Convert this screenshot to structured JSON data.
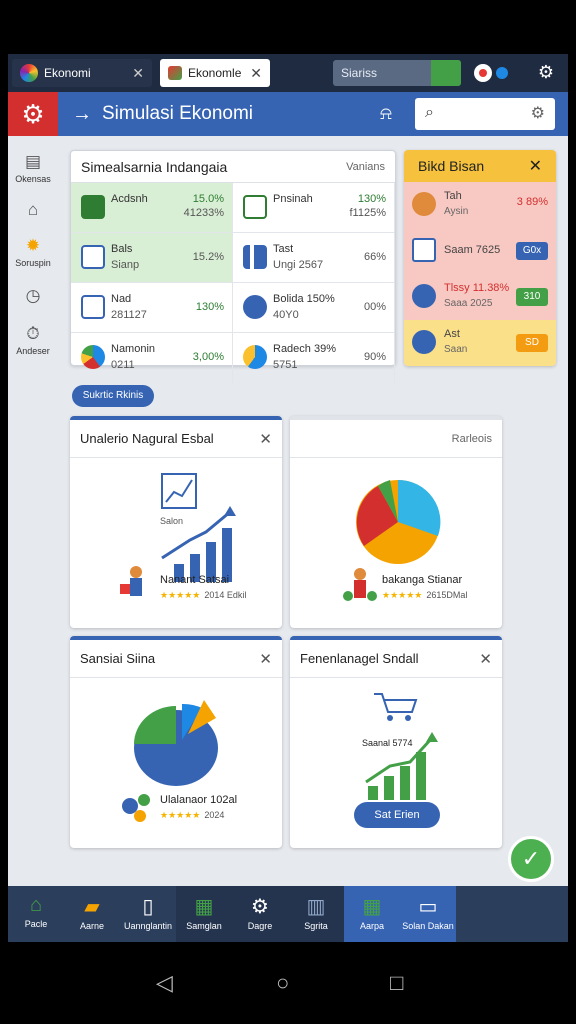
{
  "browser": {
    "tab1_label": "Ekonomi",
    "tab2_label": "Ekonomle",
    "search_label": "Siariss"
  },
  "header": {
    "title": "Simulasi Ekonomi"
  },
  "rail": {
    "items": [
      {
        "label": "Okensas"
      },
      {
        "label": ""
      },
      {
        "label": "Soruspin"
      },
      {
        "label": ""
      },
      {
        "label": "Andeser"
      }
    ]
  },
  "overview": {
    "title": "Simealsarnia Indangaia",
    "right_label": "Vanians",
    "cells": [
      {
        "label": "Acdsnh",
        "sub": "",
        "v1": "15.0%",
        "v2": "41233%"
      },
      {
        "label": "Pnsinah",
        "sub": "",
        "v1": "130%",
        "v2": "f1125%"
      },
      {
        "label": "Bals",
        "sub": "Sianp",
        "v1": "15.2%",
        "v2": ""
      },
      {
        "label": "Tast",
        "sub": "Ungi 2567",
        "v1": "66%",
        "v2": ""
      },
      {
        "label": "Nad",
        "sub": "281127",
        "v1": "130%",
        "v2": ""
      },
      {
        "label": "Bolida 150%",
        "sub": "40Y0",
        "v1": "00%",
        "v2": ""
      },
      {
        "label": "Namonin",
        "sub": "0211",
        "v1": "3,00%",
        "v2": ""
      },
      {
        "label": "Radech 39%",
        "sub": "5751",
        "v1": "90%",
        "v2": ""
      }
    ]
  },
  "side_panel": {
    "title": "Bikd Bisan",
    "rows": [
      {
        "label": "Tah",
        "sub": "Aysin",
        "value": "3 89%"
      },
      {
        "label": "Saam 7625",
        "sub": "",
        "value": "G0x"
      },
      {
        "label": "Tlssy 11.38%",
        "sub": "Saaa 2025",
        "value": "310"
      },
      {
        "label": "Ast",
        "sub": "Saan",
        "value": "SD"
      }
    ]
  },
  "section_badge": "Sukrtic Rkinis",
  "widgets": [
    {
      "title": "Unalerio Nagural Esbal",
      "caption": "Salon",
      "name": "Nanant Satsai",
      "rating": "2014 Edkil"
    },
    {
      "title": "",
      "right": "Rarleois",
      "name": "bakanga Stianar",
      "rating": "2615DMal"
    },
    {
      "title": "Sansiai Siina",
      "name": "Ulalanaor 102al",
      "rating": "2024"
    },
    {
      "title": "Fenenlanagel Sndall",
      "caption": "Saanal 5774",
      "button": "Sat Erien"
    }
  ],
  "bottom_nav": [
    {
      "label": "Pacle"
    },
    {
      "label": "Aarne"
    },
    {
      "label": "Uannglantin"
    },
    {
      "label": "Samglan"
    },
    {
      "label": "Dagre"
    },
    {
      "label": "Sgrita"
    },
    {
      "label": "Aarpa"
    },
    {
      "label": "Solan Dakan"
    }
  ],
  "colors": {
    "header": "#3664b3",
    "accent_red": "#d32f2f",
    "positive": "#2e7d32",
    "side_header": "#f6c23e"
  }
}
